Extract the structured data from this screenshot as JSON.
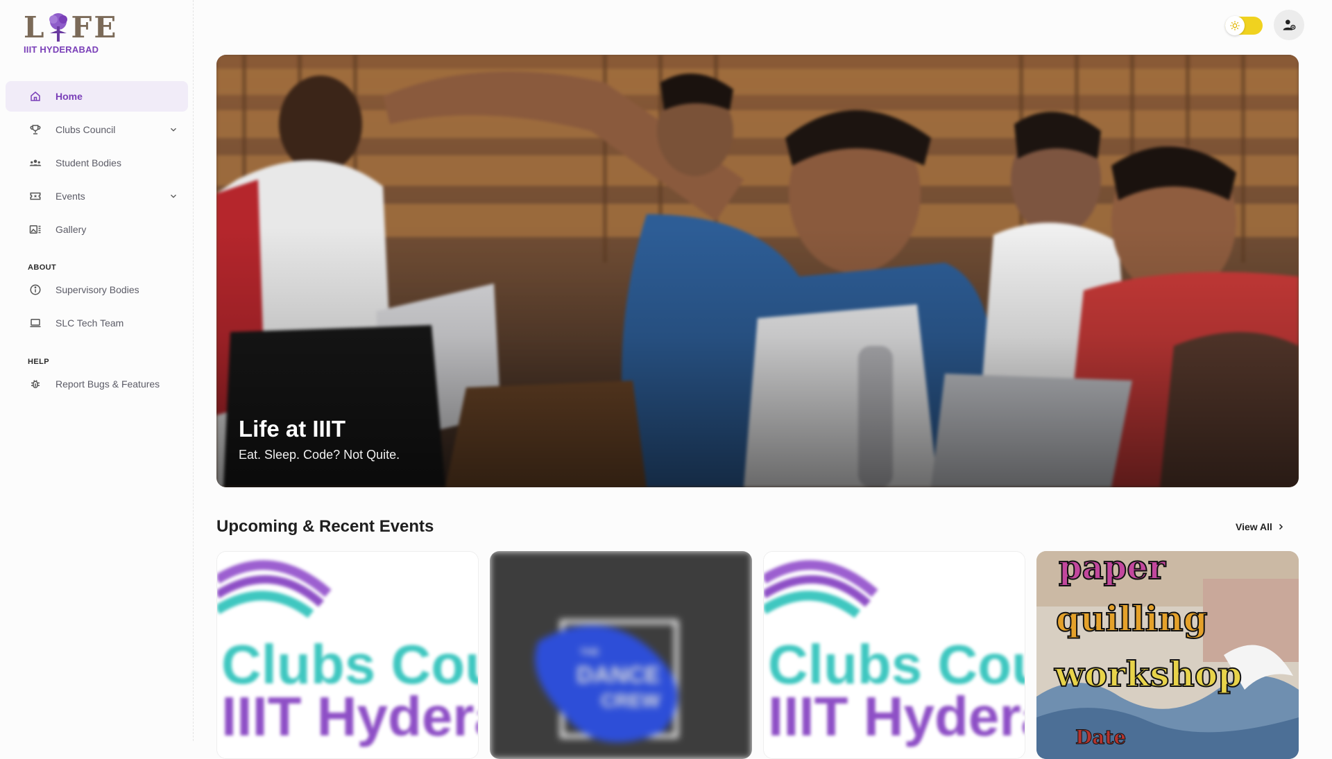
{
  "logo": {
    "letters": [
      "L",
      "F",
      "E"
    ],
    "subtitle": "IIIT HYDERABAD",
    "brand_color": "#7a3fb8"
  },
  "sidebar": {
    "main_items": [
      {
        "label": "Home",
        "icon": "home-icon",
        "active": true
      },
      {
        "label": "Clubs Council",
        "icon": "trophy-icon",
        "has_dropdown": true
      },
      {
        "label": "Student Bodies",
        "icon": "group-icon"
      },
      {
        "label": "Events",
        "icon": "ticket-icon",
        "has_dropdown": true
      },
      {
        "label": "Gallery",
        "icon": "gallery-icon"
      }
    ],
    "about_title": "ABOUT",
    "about_items": [
      {
        "label": "Supervisory Bodies",
        "icon": "info-icon"
      },
      {
        "label": "SLC Tech Team",
        "icon": "laptop-icon"
      }
    ],
    "help_title": "HELP",
    "help_items": [
      {
        "label": "Report Bugs & Features",
        "icon": "bug-icon"
      }
    ]
  },
  "topbar": {
    "theme_toggle_icon": "sun-icon",
    "account_icon": "user-login-icon",
    "toggle_color": "#f0d21f"
  },
  "hero": {
    "title": "Life at IIIT",
    "subtitle": "Eat. Sleep. Code? Not Quite."
  },
  "events": {
    "title": "Upcoming & Recent Events",
    "view_all": "View All",
    "cards": [
      {
        "kind": "clubs-council-poster",
        "line1": "Clubs Cou",
        "line2": "IIIT Hydera"
      },
      {
        "kind": "dance-crew-poster",
        "line1": "THE",
        "line2": "DANCE",
        "line3": "CREW"
      },
      {
        "kind": "clubs-council-poster",
        "line1": "Clubs Cou",
        "line2": "IIIT Hydera"
      },
      {
        "kind": "quilling-poster",
        "line1": "paper",
        "line2": "quilling",
        "line3": "workshop",
        "line4": "Date"
      }
    ]
  }
}
